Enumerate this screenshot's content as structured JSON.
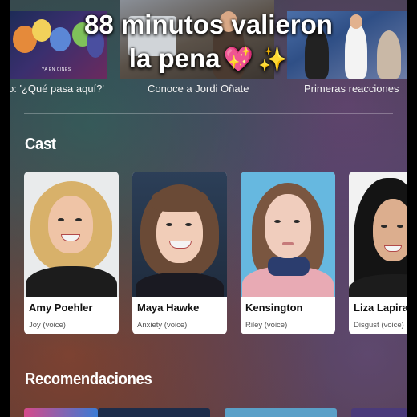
{
  "overlay": {
    "line1": "88 minutos valieron",
    "line2": "la pena",
    "emoji_heart": "💖",
    "emoji_sparkles": "✨"
  },
  "captions": [
    "o: '¿Qué pasa aquí?'",
    "Conoce a Jordi Oñate",
    "Primeras reacciones"
  ],
  "thumb_badge": "YA EN CINES",
  "sections": {
    "cast_title": "Cast",
    "recommendations_title": "Recomendaciones"
  },
  "cast": [
    {
      "name": "Amy Poehler",
      "role": "Joy (voice)"
    },
    {
      "name": "Maya Hawke",
      "role": "Anxiety (voice)"
    },
    {
      "name": "Kensington",
      "role": "Riley (voice)"
    },
    {
      "name": "Liza Lapira",
      "role": "Disgust (voice)"
    }
  ],
  "colors": {
    "card_bg": "#ffffff",
    "name_text": "#111111",
    "role_text": "#555555",
    "heading_text": "#ffffff"
  }
}
